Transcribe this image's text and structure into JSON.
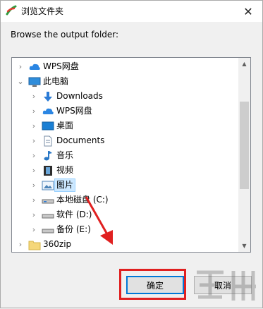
{
  "window": {
    "title": "浏览文件夹",
    "close_glyph": "✕"
  },
  "instruction": "Browse the output folder:",
  "tree": {
    "items": [
      {
        "label": "WPS网盘",
        "icon": "cloud-icon",
        "expander": ">",
        "level": 0
      },
      {
        "label": "此电脑",
        "icon": "computer-icon",
        "expander": "v",
        "level": 0
      },
      {
        "label": "Downloads",
        "icon": "download-arrow-icon",
        "expander": ">",
        "level": 1
      },
      {
        "label": "WPS网盘",
        "icon": "cloud-icon",
        "expander": ">",
        "level": 1
      },
      {
        "label": "桌面",
        "icon": "desktop-icon",
        "expander": ">",
        "level": 1
      },
      {
        "label": "Documents",
        "icon": "document-icon",
        "expander": ">",
        "level": 1
      },
      {
        "label": "音乐",
        "icon": "music-note-icon",
        "expander": ">",
        "level": 1
      },
      {
        "label": "视频",
        "icon": "film-icon",
        "expander": ">",
        "level": 1
      },
      {
        "label": "图片",
        "icon": "picture-icon",
        "expander": ">",
        "level": 1,
        "selected": true
      },
      {
        "label": "本地磁盘 (C:)",
        "icon": "drive-icon",
        "expander": ">",
        "level": 1
      },
      {
        "label": "软件 (D:)",
        "icon": "drive-icon",
        "expander": ">",
        "level": 1
      },
      {
        "label": "备份 (E:)",
        "icon": "drive-icon",
        "expander": ">",
        "level": 1
      },
      {
        "label": "360zip",
        "icon": "folder-icon",
        "expander": ">",
        "level": 0
      }
    ]
  },
  "buttons": {
    "ok": "确定",
    "cancel": "取消"
  },
  "colors": {
    "highlight": "#e02020",
    "selection": "#cce8ff",
    "accent": "#0078d7"
  }
}
